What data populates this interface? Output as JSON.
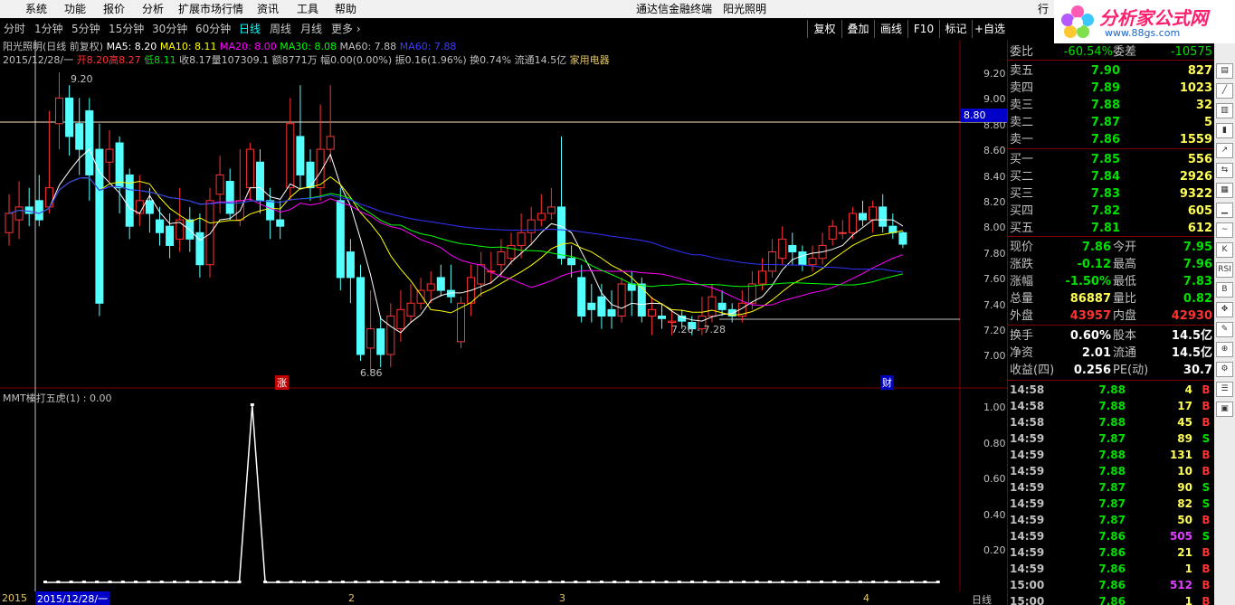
{
  "menu": [
    "系统",
    "功能",
    "报价",
    "分析",
    "扩展市场行情",
    "资讯",
    "工具",
    "帮助"
  ],
  "app_title": "通达信金融终端",
  "stock_title": "阳光照明",
  "window_button": "行",
  "logo": {
    "name": "分析家公式网",
    "url_text": "www.88gs.com"
  },
  "periods": [
    "分时",
    "1分钟",
    "5分钟",
    "15分钟",
    "30分钟",
    "60分钟",
    "日线",
    "周线",
    "月线",
    "更多 ›"
  ],
  "active_period": "日线",
  "toolbar_buttons": [
    "复权",
    "叠加",
    "画线",
    "F10",
    "标记",
    "+自选"
  ],
  "info_line1": {
    "name": "阳光照明(日线 前复权)",
    "ma5": "MA5: 8.20",
    "ma10": "MA10: 8.11",
    "ma20": "MA20: 8.00",
    "ma30": "MA30: 8.08",
    "ma60": "MA60: 7.88",
    "ma60b": "MA60: 7.88"
  },
  "info_line2": {
    "date": "2015/12/28/一",
    "open": "开8.20",
    "high": "高8.27",
    "low": "低8.11",
    "close": "收8.17",
    "vol": "量107309.1",
    "amt": "额8771万",
    "chg": "幅0.00(0.00%)",
    "amp": "振0.16(1.96%)",
    "turn": "换0.74%",
    "float": "流通14.5亿",
    "sector": "家用电器"
  },
  "colors": {
    "up": "#ff3232",
    "down": "#54ffff",
    "ma5": "#ffffff",
    "ma10": "#ffff00",
    "ma20": "#ff00ff",
    "ma30": "#00ff00",
    "ma60": "#3232ff",
    "grid": "#800000"
  },
  "price_axis": [
    "9.20",
    "9.00",
    "8.80",
    "8.60",
    "8.40",
    "8.20",
    "8.00",
    "7.80",
    "7.60",
    "7.40",
    "7.20",
    "7.00"
  ],
  "current_price_tag": "8.80",
  "annotations": {
    "high": "9.20",
    "low": "6.86",
    "range": "7.26 - 7.28",
    "mark_zhang": "涨",
    "mark_cai": "财"
  },
  "indicator": {
    "title": "MMT榛打五虎(1) : 0.00",
    "axis": [
      "1.00",
      "0.80",
      "0.60",
      "0.40",
      "0.20"
    ]
  },
  "date_axis": [
    "2015",
    "2015/12/28/一",
    "2",
    "3",
    "4"
  ],
  "period_label": "日线",
  "quote": {
    "wei_bi_label": "委比",
    "wei_bi": "-60.54%",
    "wei_cha_label": "委差",
    "wei_cha": "-10575",
    "asks": [
      [
        "卖五",
        "7.90",
        "827"
      ],
      [
        "卖四",
        "7.89",
        "1023"
      ],
      [
        "卖三",
        "7.88",
        "32"
      ],
      [
        "卖二",
        "7.87",
        "5"
      ],
      [
        "卖一",
        "7.86",
        "1559"
      ]
    ],
    "bids": [
      [
        "买一",
        "7.85",
        "556"
      ],
      [
        "买二",
        "7.84",
        "2926"
      ],
      [
        "买三",
        "7.83",
        "9322"
      ],
      [
        "买四",
        "7.82",
        "605"
      ],
      [
        "买五",
        "7.81",
        "612"
      ]
    ],
    "stats": [
      [
        "现价",
        "7.86",
        "今开",
        "7.95"
      ],
      [
        "涨跌",
        "-0.12",
        "最高",
        "7.96"
      ],
      [
        "涨幅",
        "-1.50%",
        "最低",
        "7.83"
      ],
      [
        "总量",
        "86887",
        "量比",
        "0.82"
      ],
      [
        "外盘",
        "43957",
        "内盘",
        "42930"
      ]
    ],
    "stats2": [
      [
        "换手",
        "0.60%",
        "股本",
        "14.5亿"
      ],
      [
        "净资",
        "2.01",
        "流通",
        "14.5亿"
      ],
      [
        "收益(四)",
        "0.256",
        "PE(动)",
        "30.7"
      ]
    ]
  },
  "ticks": [
    [
      "14:58",
      "7.88",
      "4",
      "B"
    ],
    [
      "14:58",
      "7.88",
      "17",
      "B"
    ],
    [
      "14:58",
      "7.88",
      "45",
      "B"
    ],
    [
      "14:59",
      "7.87",
      "89",
      "S"
    ],
    [
      "14:59",
      "7.88",
      "131",
      "B"
    ],
    [
      "14:59",
      "7.88",
      "10",
      "B"
    ],
    [
      "14:59",
      "7.87",
      "90",
      "S"
    ],
    [
      "14:59",
      "7.87",
      "82",
      "S"
    ],
    [
      "14:59",
      "7.87",
      "50",
      "B"
    ],
    [
      "14:59",
      "7.86",
      "505",
      "S"
    ],
    [
      "14:59",
      "7.86",
      "21",
      "B"
    ],
    [
      "14:59",
      "7.86",
      "1",
      "B"
    ],
    [
      "15:00",
      "7.86",
      "512",
      "B"
    ],
    [
      "15:00",
      "7.86",
      "1",
      "B"
    ]
  ],
  "candles": [
    [
      7.95,
      8.1,
      8.25,
      7.85
    ],
    [
      8.05,
      8.15,
      8.35,
      7.9
    ],
    [
      8.15,
      8.1,
      8.3,
      8.0
    ],
    [
      8.2,
      8.05,
      8.4,
      8.0
    ],
    [
      8.15,
      8.3,
      8.9,
      8.1
    ],
    [
      8.8,
      9.0,
      9.2,
      8.6
    ],
    [
      9.0,
      8.7,
      9.1,
      8.55
    ],
    [
      8.8,
      8.6,
      9.0,
      8.4
    ],
    [
      8.9,
      8.4,
      9.0,
      8.2
    ],
    [
      8.6,
      7.4,
      8.8,
      7.3
    ],
    [
      8.5,
      8.6,
      8.75,
      8.35
    ],
    [
      8.65,
      8.3,
      8.7,
      8.1
    ],
    [
      8.4,
      8.0,
      8.45,
      7.9
    ],
    [
      8.1,
      8.2,
      8.4,
      8.0
    ],
    [
      8.2,
      8.1,
      8.3,
      7.95
    ],
    [
      8.05,
      7.95,
      8.15,
      7.85
    ],
    [
      8.0,
      7.85,
      8.1,
      7.75
    ],
    [
      7.9,
      8.05,
      8.3,
      7.8
    ],
    [
      8.05,
      7.9,
      8.15,
      7.8
    ],
    [
      7.95,
      7.7,
      8.1,
      7.6
    ],
    [
      7.7,
      8.2,
      8.3,
      7.6
    ],
    [
      8.25,
      8.4,
      8.55,
      8.1
    ],
    [
      8.35,
      8.1,
      8.45,
      8.05
    ],
    [
      8.05,
      8.2,
      8.6,
      8.0
    ],
    [
      8.3,
      8.6,
      8.65,
      8.2
    ],
    [
      8.5,
      8.2,
      8.6,
      8.1
    ],
    [
      8.2,
      8.05,
      8.3,
      7.9
    ],
    [
      8.05,
      8.0,
      8.2,
      7.9
    ],
    [
      8.3,
      8.8,
      9.0,
      8.2
    ],
    [
      8.7,
      8.4,
      9.1,
      8.3
    ],
    [
      8.5,
      8.3,
      8.6,
      8.2
    ],
    [
      8.3,
      8.6,
      8.95,
      8.2
    ],
    [
      8.6,
      8.7,
      9.1,
      8.5
    ],
    [
      8.2,
      7.6,
      8.3,
      7.5
    ],
    [
      7.8,
      7.6,
      7.9,
      7.4
    ],
    [
      7.6,
      7.0,
      7.7,
      6.95
    ],
    [
      7.05,
      7.2,
      7.5,
      6.86
    ],
    [
      7.2,
      7.0,
      7.3,
      6.9
    ],
    [
      7.0,
      7.3,
      7.4,
      6.9
    ],
    [
      7.2,
      7.35,
      7.5,
      7.1
    ],
    [
      7.3,
      7.4,
      7.55,
      7.25
    ],
    [
      7.4,
      7.5,
      7.6,
      7.35
    ],
    [
      7.5,
      7.55,
      7.65,
      7.4
    ],
    [
      7.6,
      7.5,
      7.7,
      7.45
    ],
    [
      7.5,
      7.45,
      7.7,
      7.4
    ],
    [
      7.1,
      7.4,
      7.45,
      7.05
    ],
    [
      7.4,
      7.6,
      7.7,
      7.3
    ],
    [
      7.55,
      7.7,
      7.8,
      7.45
    ],
    [
      7.65,
      7.65,
      7.8,
      7.55
    ],
    [
      7.7,
      7.8,
      7.9,
      7.6
    ],
    [
      7.75,
      7.85,
      7.95,
      7.7
    ],
    [
      7.85,
      7.95,
      8.1,
      7.75
    ],
    [
      7.95,
      8.05,
      8.15,
      7.85
    ],
    [
      8.05,
      8.1,
      8.25,
      8.0
    ],
    [
      8.1,
      8.15,
      8.3,
      8.05
    ],
    [
      8.15,
      7.75,
      8.7,
      7.7
    ],
    [
      7.75,
      7.7,
      7.85,
      7.6
    ],
    [
      7.6,
      7.3,
      7.7,
      7.25
    ],
    [
      7.4,
      7.35,
      7.55,
      7.25
    ],
    [
      7.45,
      7.3,
      7.55,
      7.2
    ],
    [
      7.35,
      7.3,
      7.5,
      7.2
    ],
    [
      7.3,
      7.55,
      7.6,
      7.25
    ],
    [
      7.55,
      7.5,
      7.65,
      7.3
    ],
    [
      7.55,
      7.3,
      7.6,
      7.25
    ],
    [
      7.3,
      7.35,
      7.45,
      7.15
    ],
    [
      7.3,
      7.28,
      7.4,
      7.2
    ],
    [
      7.25,
      7.26,
      7.35,
      7.15
    ],
    [
      7.3,
      7.26,
      7.35,
      7.2
    ],
    [
      7.25,
      7.2,
      7.3,
      7.15
    ],
    [
      7.2,
      7.3,
      7.45,
      7.15
    ],
    [
      7.3,
      7.45,
      7.55,
      7.25
    ],
    [
      7.4,
      7.35,
      7.5,
      7.3
    ],
    [
      7.35,
      7.3,
      7.4,
      7.25
    ],
    [
      7.3,
      7.4,
      7.5,
      7.25
    ],
    [
      7.4,
      7.55,
      7.65,
      7.35
    ],
    [
      7.55,
      7.65,
      7.75,
      7.5
    ],
    [
      7.65,
      7.8,
      7.9,
      7.6
    ],
    [
      7.75,
      7.9,
      8.0,
      7.7
    ],
    [
      7.85,
      7.8,
      7.95,
      7.7
    ],
    [
      7.8,
      7.7,
      7.85,
      7.65
    ],
    [
      7.7,
      7.75,
      7.85,
      7.65
    ],
    [
      7.75,
      7.85,
      7.95,
      7.7
    ],
    [
      7.9,
      8.0,
      8.05,
      7.85
    ],
    [
      7.95,
      7.95,
      8.05,
      7.9
    ],
    [
      7.95,
      8.1,
      8.15,
      7.9
    ],
    [
      8.1,
      8.05,
      8.2,
      8.0
    ],
    [
      8.05,
      8.15,
      8.2,
      7.95
    ],
    [
      8.15,
      8.0,
      8.25,
      7.95
    ],
    [
      8.0,
      7.95,
      8.1,
      7.9
    ],
    [
      7.95,
      7.86,
      7.96,
      7.83
    ]
  ],
  "indicator_values": [
    0,
    0,
    0,
    0,
    0,
    0,
    0,
    0,
    0,
    0,
    0,
    0,
    0,
    0,
    0,
    0,
    1,
    0,
    0,
    0,
    0,
    0,
    0,
    0,
    0,
    0,
    0,
    0,
    0,
    0,
    0,
    0,
    0,
    0,
    0,
    0,
    0,
    0,
    0,
    0,
    0,
    0,
    0,
    0,
    0,
    0,
    0,
    0,
    0,
    0,
    0,
    0,
    0,
    0,
    0,
    0,
    0,
    0,
    0,
    0,
    0,
    0,
    0,
    0,
    0,
    0,
    0,
    0,
    0,
    0
  ]
}
